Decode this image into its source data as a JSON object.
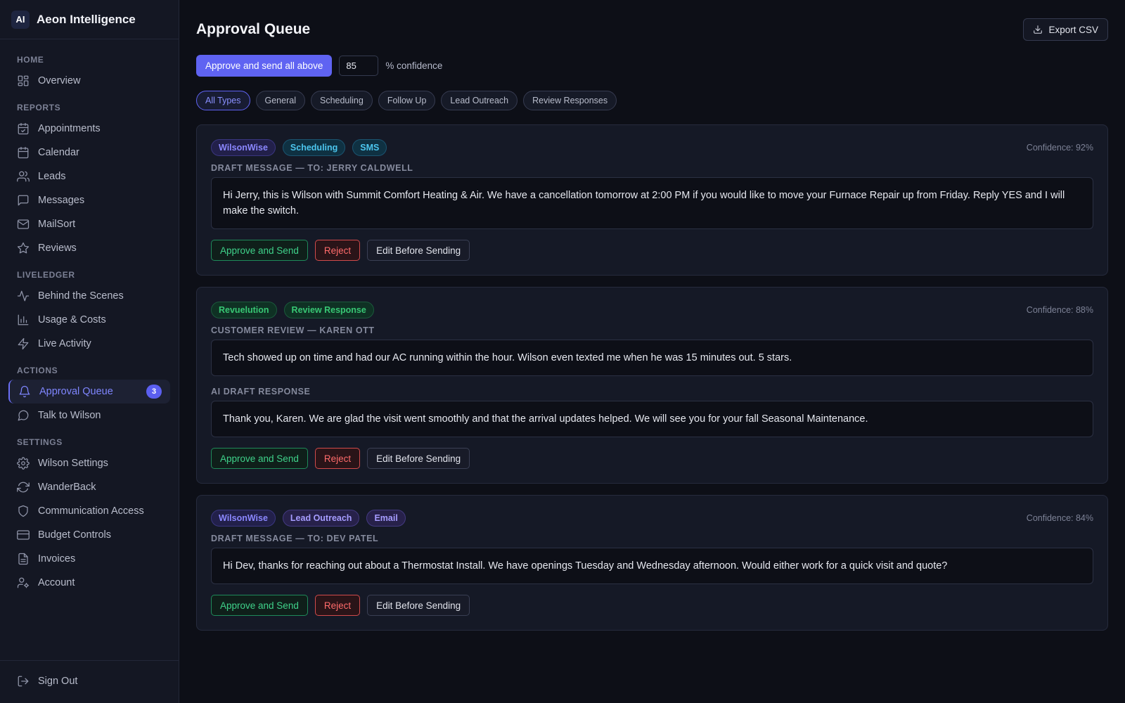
{
  "brand": {
    "logo": "AI",
    "name": "Aeon Intelligence"
  },
  "sidebar": {
    "sections": [
      {
        "title": "HOME",
        "items": [
          {
            "label": "Overview",
            "icon": "grid-icon"
          }
        ]
      },
      {
        "title": "REPORTS",
        "items": [
          {
            "label": "Appointments",
            "icon": "calendar-check-icon"
          },
          {
            "label": "Calendar",
            "icon": "calendar-icon"
          },
          {
            "label": "Leads",
            "icon": "users-icon"
          },
          {
            "label": "Messages",
            "icon": "message-square-icon"
          },
          {
            "label": "MailSort",
            "icon": "mail-icon"
          },
          {
            "label": "Reviews",
            "icon": "star-icon"
          }
        ]
      },
      {
        "title": "LIVELEDGER",
        "items": [
          {
            "label": "Behind the Scenes",
            "icon": "activity-icon"
          },
          {
            "label": "Usage & Costs",
            "icon": "bar-chart-icon"
          },
          {
            "label": "Live Activity",
            "icon": "zap-icon"
          }
        ]
      },
      {
        "title": "ACTIONS",
        "items": [
          {
            "label": "Approval Queue",
            "icon": "bell-icon",
            "active": true,
            "badge": "3"
          },
          {
            "label": "Talk to Wilson",
            "icon": "chat-bubble-icon"
          }
        ]
      },
      {
        "title": "SETTINGS",
        "items": [
          {
            "label": "Wilson Settings",
            "icon": "gear-icon"
          },
          {
            "label": "WanderBack",
            "icon": "refresh-icon"
          },
          {
            "label": "Communication Access",
            "icon": "shield-icon"
          },
          {
            "label": "Budget Controls",
            "icon": "credit-card-icon"
          },
          {
            "label": "Invoices",
            "icon": "file-text-icon"
          },
          {
            "label": "Account",
            "icon": "user-gear-icon"
          }
        ]
      }
    ],
    "signout": "Sign Out"
  },
  "main": {
    "title": "Approval Queue",
    "export_label": "Export CSV",
    "bulk_label": "Approve and send all above",
    "confidence_value": "85",
    "confidence_suffix": "% confidence",
    "filters": [
      "All Types",
      "General",
      "Scheduling",
      "Follow Up",
      "Lead Outreach",
      "Review Responses"
    ],
    "active_filter": 0,
    "actions": {
      "approve": "Approve and Send",
      "reject": "Reject",
      "edit": "Edit Before Sending"
    },
    "cards": [
      {
        "tags": [
          {
            "text": "WilsonWise",
            "style": "purple"
          },
          {
            "text": "Scheduling",
            "style": "teal"
          },
          {
            "text": "SMS",
            "style": "teal"
          }
        ],
        "confidence": "Confidence: 92%",
        "blocks": [
          {
            "label": "DRAFT MESSAGE — TO: JERRY CALDWELL",
            "text": "Hi Jerry, this is Wilson with Summit Comfort Heating & Air. We have a cancellation tomorrow at 2:00 PM if you would like to move your Furnace Repair up from Friday. Reply YES and I will make the switch."
          }
        ]
      },
      {
        "tags": [
          {
            "text": "Revuelution",
            "style": "green"
          },
          {
            "text": "Review Response",
            "style": "green"
          }
        ],
        "confidence": "Confidence: 88%",
        "blocks": [
          {
            "label": "CUSTOMER REVIEW — KAREN OTT",
            "text": "Tech showed up on time and had our AC running within the hour. Wilson even texted me when he was 15 minutes out. 5 stars."
          },
          {
            "label": "AI DRAFT RESPONSE",
            "text": "Thank you, Karen. We are glad the visit went smoothly and that the arrival updates helped. We will see you for your fall Seasonal Maintenance."
          }
        ]
      },
      {
        "tags": [
          {
            "text": "WilsonWise",
            "style": "purple"
          },
          {
            "text": "Lead Outreach",
            "style": "violet"
          },
          {
            "text": "Email",
            "style": "violet"
          }
        ],
        "confidence": "Confidence: 84%",
        "blocks": [
          {
            "label": "DRAFT MESSAGE — TO: DEV PATEL",
            "text": "Hi Dev, thanks for reaching out about a Thermostat Install. We have openings Tuesday and Wednesday afternoon. Would either work for a quick visit and quote?"
          }
        ]
      }
    ]
  }
}
